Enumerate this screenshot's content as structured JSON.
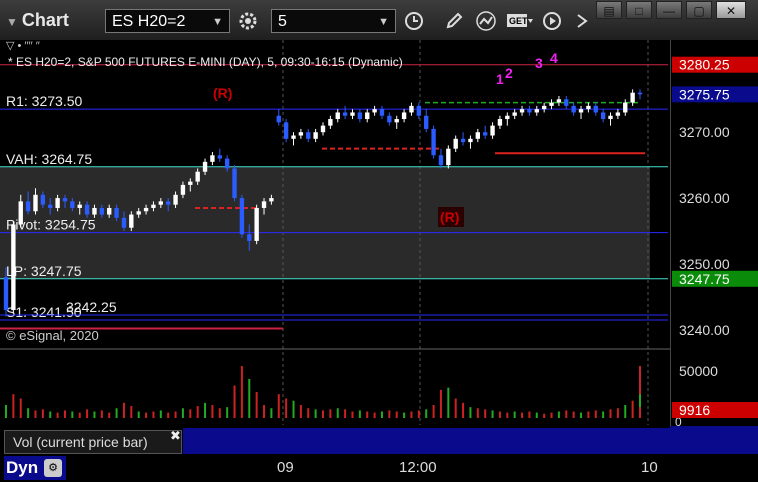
{
  "window": {
    "title": "Chart"
  },
  "toolbar": {
    "symbol": "ES H20=2",
    "interval": "5",
    "icons": [
      "gear-icon",
      "clock-icon",
      "pencil-icon",
      "chart-line-icon",
      "get-icon",
      "play-icon",
      "drag-icon"
    ]
  },
  "window_controls": [
    "restore-icon",
    "minimize-icon",
    "maximize-icon",
    "close-icon"
  ],
  "chart_data": {
    "type": "candlestick",
    "header_line1": "▽ • ′′′′ ′′",
    "header_line2": "* ES H20=2, S&P 500 FUTURES E-MINI (DAY), 5, 09:30-16:15 (Dynamic)",
    "watermark": "© eSignal, 2020",
    "ylim": [
      3238.0,
      3284.0
    ],
    "y_ticks": [
      3240.0,
      3250.0,
      3260.0,
      3270.0,
      3280.0
    ],
    "y_tick_labels": [
      "3240.00",
      "3250.00",
      "3260.00",
      "3270.00",
      "3280.25"
    ],
    "x_tick_labels": [
      "09",
      "12:00",
      "10"
    ],
    "levels": [
      {
        "name": "R1",
        "label": "R1: 3273.50",
        "value": 3273.5,
        "color": "#2a2aff"
      },
      {
        "name": "VAH",
        "label": "VAH: 3264.75",
        "value": 3264.75,
        "color": "#40e0d0"
      },
      {
        "name": "Pivot",
        "label": "Pivot: 3254.75",
        "value": 3254.75,
        "color": "#2a2aff"
      },
      {
        "name": "LP",
        "label": "LP: 3247.75",
        "value": 3247.75,
        "color": "#40e0d0"
      },
      {
        "name": "S1",
        "label": "S1: 3241.50",
        "value": 3241.5,
        "color": "#2a2aff"
      },
      {
        "name": "Other",
        "label": "3242.25",
        "value": 3242.25,
        "color": "#2a2aff"
      }
    ],
    "price_badges": [
      {
        "value": 3280.25,
        "label": "3280.25",
        "bg": "#cc0000",
        "fg": "#ffffff"
      },
      {
        "value": 3275.75,
        "label": "3275.75",
        "bg": "#0a0a8c",
        "fg": "#ffffff"
      },
      {
        "value": 3247.75,
        "label": "3247.75",
        "bg": "#0a8c0a",
        "fg": "#ffffff"
      }
    ],
    "r_markers": [
      "(R)",
      "(R)"
    ],
    "count_labels_magenta": [
      "1",
      "2",
      "3",
      "4"
    ],
    "volume": {
      "label": "Vol (current price bar)",
      "y_ticks": [
        0,
        50000
      ],
      "y_tick_labels": [
        "0",
        "50000"
      ],
      "current": "9916"
    },
    "ohlc": [
      [
        3248.0,
        3249.5,
        3242.0,
        3243.0
      ],
      [
        3243.0,
        3256.5,
        3242.5,
        3256.0
      ],
      [
        3256.0,
        3260.5,
        3255.5,
        3259.5
      ],
      [
        3259.5,
        3261.0,
        3257.5,
        3258.0
      ],
      [
        3258.0,
        3261.5,
        3257.5,
        3260.5
      ],
      [
        3260.5,
        3261.0,
        3258.5,
        3259.0
      ],
      [
        3259.0,
        3260.0,
        3257.5,
        3258.5
      ],
      [
        3258.5,
        3260.5,
        3258.0,
        3260.0
      ],
      [
        3260.0,
        3260.5,
        3258.5,
        3259.5
      ],
      [
        3259.5,
        3260.0,
        3258.0,
        3258.5
      ],
      [
        3258.5,
        3259.5,
        3257.5,
        3259.0
      ],
      [
        3259.0,
        3259.5,
        3257.0,
        3257.5
      ],
      [
        3257.5,
        3259.0,
        3257.0,
        3258.5
      ],
      [
        3258.5,
        3259.0,
        3257.0,
        3257.5
      ],
      [
        3257.5,
        3259.0,
        3257.0,
        3258.5
      ],
      [
        3258.5,
        3259.0,
        3256.5,
        3257.0
      ],
      [
        3257.0,
        3258.0,
        3255.0,
        3255.5
      ],
      [
        3255.5,
        3258.0,
        3255.0,
        3257.5
      ],
      [
        3257.5,
        3258.5,
        3257.0,
        3258.0
      ],
      [
        3258.0,
        3259.0,
        3257.5,
        3258.5
      ],
      [
        3258.5,
        3259.5,
        3258.0,
        3259.0
      ],
      [
        3259.0,
        3260.0,
        3258.5,
        3259.5
      ],
      [
        3259.5,
        3260.0,
        3258.0,
        3259.0
      ],
      [
        3259.0,
        3261.0,
        3258.5,
        3260.5
      ],
      [
        3260.5,
        3262.5,
        3260.0,
        3262.0
      ],
      [
        3262.0,
        3263.0,
        3261.0,
        3262.5
      ],
      [
        3262.5,
        3264.5,
        3262.0,
        3264.0
      ],
      [
        3264.0,
        3266.0,
        3263.5,
        3265.5
      ],
      [
        3265.5,
        3267.0,
        3265.0,
        3266.5
      ],
      [
        3266.5,
        3267.5,
        3265.5,
        3266.0
      ],
      [
        3266.0,
        3266.5,
        3264.0,
        3264.5
      ],
      [
        3264.5,
        3265.0,
        3259.5,
        3260.0
      ],
      [
        3260.0,
        3260.5,
        3254.0,
        3254.5
      ],
      [
        3254.5,
        3256.0,
        3252.0,
        3253.5
      ],
      [
        3253.5,
        3259.0,
        3253.0,
        3258.5
      ],
      [
        3258.5,
        3260.0,
        3257.5,
        3259.5
      ],
      [
        3259.5,
        3260.5,
        3259.0,
        3260.0
      ],
      [
        3272.5,
        3273.5,
        3271.0,
        3271.5
      ],
      [
        3271.5,
        3272.0,
        3268.5,
        3269.0
      ],
      [
        3269.0,
        3270.0,
        3268.0,
        3269.5
      ],
      [
        3269.5,
        3270.5,
        3269.0,
        3270.0
      ],
      [
        3270.0,
        3270.5,
        3268.5,
        3269.0
      ],
      [
        3269.0,
        3270.5,
        3268.5,
        3270.0
      ],
      [
        3270.0,
        3271.5,
        3269.5,
        3271.0
      ],
      [
        3271.0,
        3272.5,
        3270.5,
        3272.0
      ],
      [
        3272.0,
        3273.5,
        3271.5,
        3273.0
      ],
      [
        3273.0,
        3274.0,
        3272.0,
        3272.5
      ],
      [
        3272.5,
        3273.5,
        3272.0,
        3273.0
      ],
      [
        3273.0,
        3273.5,
        3271.5,
        3272.0
      ],
      [
        3272.0,
        3273.5,
        3271.5,
        3273.0
      ],
      [
        3273.0,
        3274.0,
        3272.5,
        3273.5
      ],
      [
        3273.5,
        3274.0,
        3272.0,
        3272.5
      ],
      [
        3272.5,
        3273.0,
        3271.0,
        3271.5
      ],
      [
        3271.5,
        3272.5,
        3270.5,
        3272.0
      ],
      [
        3272.0,
        3273.5,
        3271.5,
        3273.0
      ],
      [
        3273.0,
        3274.5,
        3272.5,
        3274.0
      ],
      [
        3274.0,
        3274.5,
        3272.0,
        3272.5
      ],
      [
        3272.5,
        3273.5,
        3270.0,
        3270.5
      ],
      [
        3270.5,
        3271.0,
        3266.0,
        3266.5
      ],
      [
        3266.5,
        3267.5,
        3264.5,
        3265.0
      ],
      [
        3265.0,
        3268.0,
        3264.5,
        3267.5
      ],
      [
        3267.5,
        3269.5,
        3267.0,
        3269.0
      ],
      [
        3269.0,
        3270.0,
        3268.0,
        3268.5
      ],
      [
        3268.5,
        3269.5,
        3267.5,
        3269.0
      ],
      [
        3269.0,
        3270.5,
        3268.5,
        3270.0
      ],
      [
        3270.0,
        3271.0,
        3269.0,
        3269.5
      ],
      [
        3269.5,
        3271.5,
        3269.0,
        3271.0
      ],
      [
        3271.0,
        3272.5,
        3270.5,
        3272.0
      ],
      [
        3272.0,
        3273.0,
        3271.0,
        3272.5
      ],
      [
        3272.5,
        3273.5,
        3272.0,
        3273.0
      ],
      [
        3273.0,
        3274.0,
        3272.5,
        3273.5
      ],
      [
        3273.5,
        3274.0,
        3272.5,
        3273.0
      ],
      [
        3273.0,
        3274.0,
        3272.5,
        3273.5
      ],
      [
        3273.5,
        3274.5,
        3273.0,
        3274.0
      ],
      [
        3274.0,
        3275.0,
        3273.5,
        3274.5
      ],
      [
        3274.5,
        3275.5,
        3274.0,
        3275.0
      ],
      [
        3275.0,
        3275.5,
        3273.5,
        3274.0
      ],
      [
        3274.0,
        3274.5,
        3272.5,
        3273.0
      ],
      [
        3273.0,
        3274.0,
        3272.0,
        3273.5
      ],
      [
        3273.5,
        3274.5,
        3273.0,
        3274.0
      ],
      [
        3274.0,
        3274.5,
        3272.5,
        3273.0
      ],
      [
        3273.0,
        3273.5,
        3271.5,
        3272.0
      ],
      [
        3272.0,
        3273.0,
        3271.0,
        3272.5
      ],
      [
        3272.5,
        3273.5,
        3272.0,
        3273.0
      ],
      [
        3273.0,
        3275.0,
        3272.5,
        3274.5
      ],
      [
        3274.5,
        3276.5,
        3274.0,
        3276.0
      ],
      [
        3276.0,
        3276.5,
        3275.0,
        3275.75
      ]
    ],
    "volume_values": [
      12000,
      22000,
      18000,
      9000,
      7000,
      8000,
      6000,
      5000,
      7000,
      6000,
      5000,
      8000,
      6000,
      7000,
      5000,
      9000,
      14000,
      11000,
      6000,
      5000,
      6000,
      7000,
      5000,
      6000,
      9000,
      8000,
      11000,
      14000,
      12000,
      9000,
      10000,
      30000,
      48000,
      36000,
      24000,
      12000,
      9000,
      22000,
      18000,
      16000,
      12000,
      9000,
      8000,
      7000,
      8000,
      9000,
      8000,
      6000,
      7000,
      6000,
      5000,
      6000,
      7000,
      6000,
      5000,
      6000,
      7000,
      8000,
      12000,
      26000,
      28000,
      18000,
      14000,
      10000,
      9000,
      8000,
      7000,
      6000,
      5000,
      6000,
      5000,
      6000,
      5000,
      4000,
      5000,
      6000,
      7000,
      6000,
      5000,
      6000,
      7000,
      6000,
      8000,
      9000,
      12000,
      16000,
      48000,
      22000,
      9916
    ]
  }
}
